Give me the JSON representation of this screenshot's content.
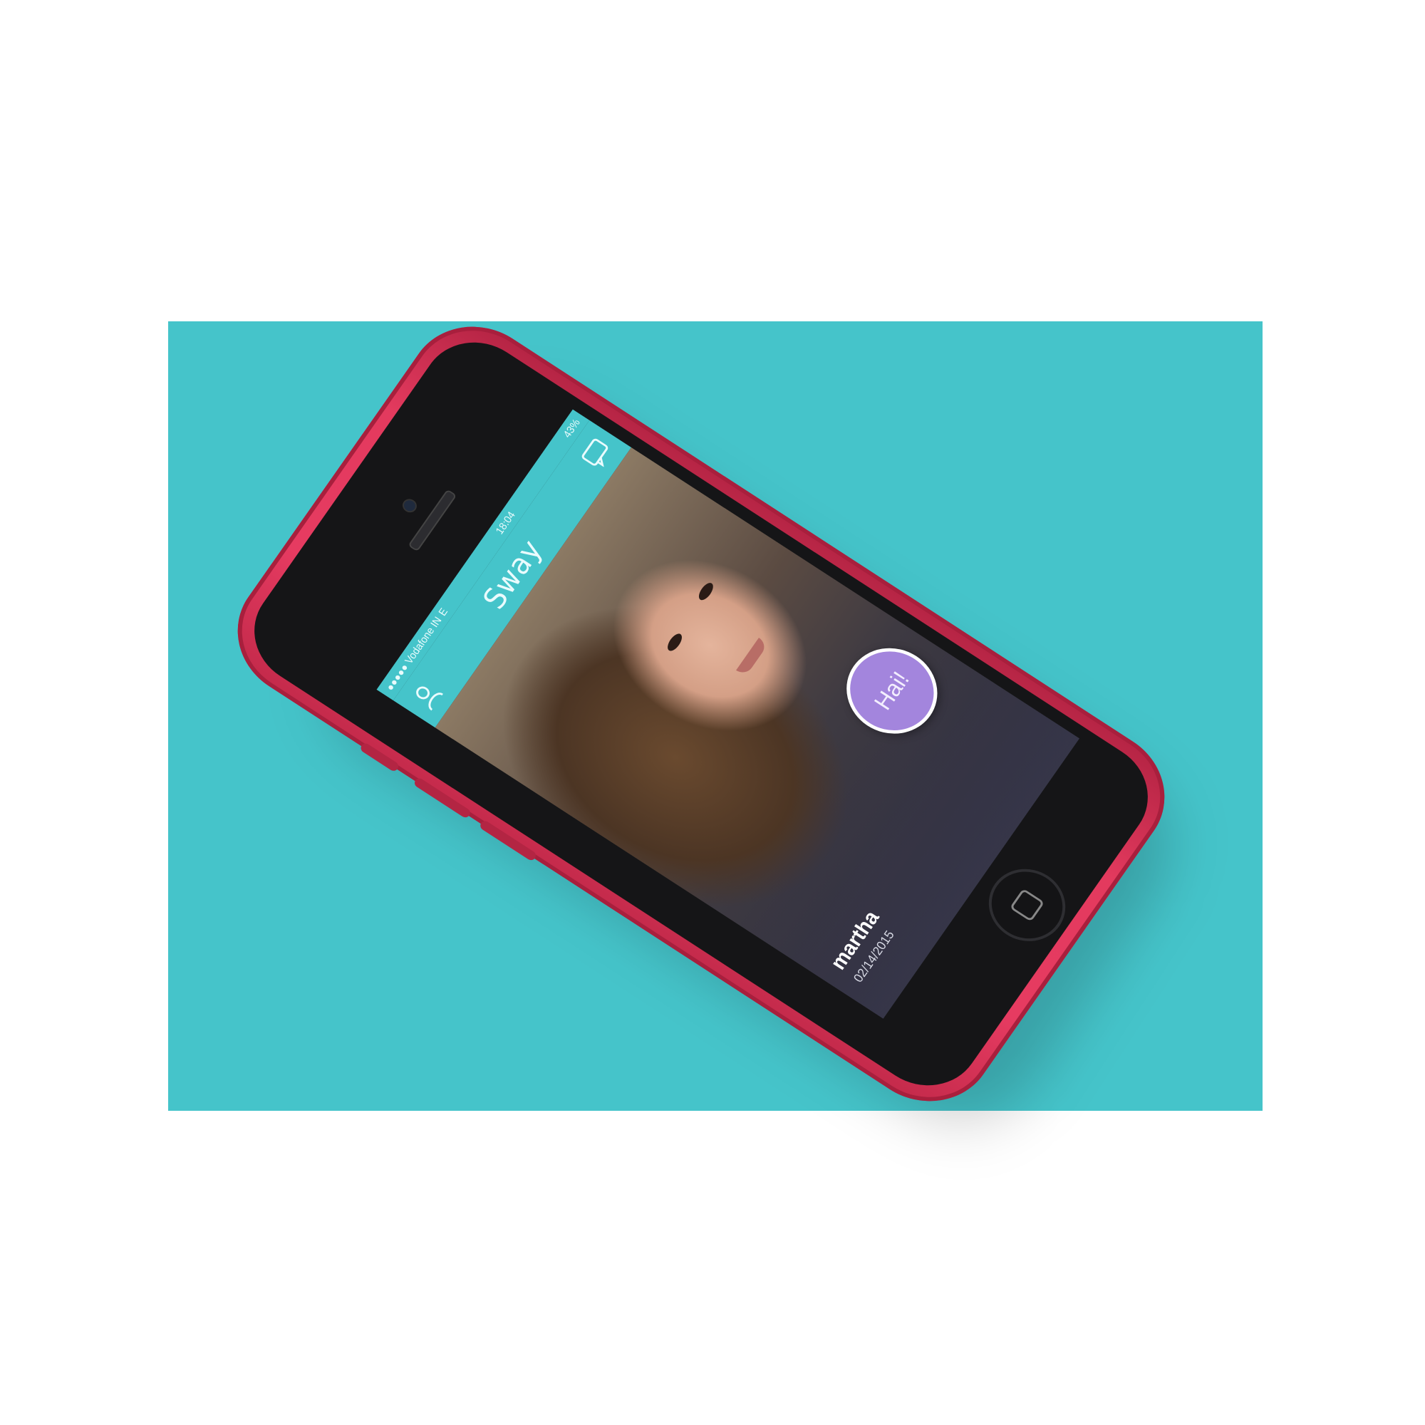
{
  "colors": {
    "backdrop": "#45c4ca",
    "phone_case": "#e33a5e",
    "app_bar": "#45c4ca",
    "hai_button": "#a385dd"
  },
  "status_bar": {
    "carrier": "●●●●● Vodafone IN",
    "network": "E",
    "time": "18:04",
    "battery": "43%"
  },
  "app": {
    "title": "Sway",
    "left_icon": "profile-icon",
    "right_icon": "chat-icon"
  },
  "profile": {
    "name": "martha",
    "date": "02/14/2015"
  },
  "action": {
    "label": "Hai!"
  }
}
